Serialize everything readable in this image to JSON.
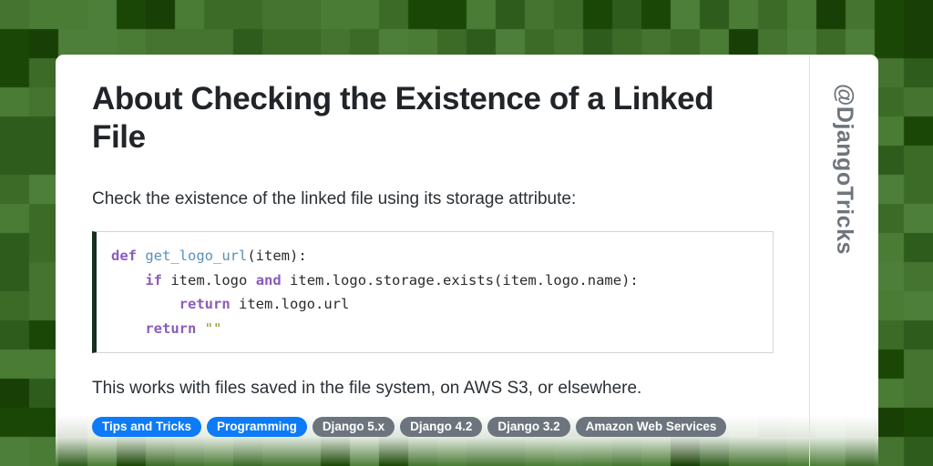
{
  "background": {
    "name": "pixel-checker-green",
    "cell_size": 32,
    "palette": [
      "#4a7c35",
      "#4e7f3a",
      "#3c6b28",
      "#2e5c1c",
      "#1b4706",
      "#183f05",
      "#447430"
    ]
  },
  "card": {
    "title": "About Checking the Existence of a Linked File",
    "intro_text": "Check the existence of the linked file using its storage attribute:",
    "outro_text": "This works with files saved in the file system, on AWS S3, or elsewhere.",
    "code": {
      "language": "python",
      "lines": [
        "def get_logo_url(item):",
        "    if item.logo and item.logo.storage.exists(item.logo.name):",
        "        return item.logo.url",
        "    return \"\""
      ],
      "plain_text": "def get_logo_url(item):\n    if item.logo and item.logo.storage.exists(item.logo.name):\n        return item.logo.url\n    return \"\"",
      "accent_color": "#16301d",
      "keyword_color": "#8b5cbb",
      "function_color": "#5b8fb8",
      "string_color": "#8a9a1e"
    },
    "tags": [
      {
        "label": "Tips and Tricks",
        "style": "primary"
      },
      {
        "label": "Programming",
        "style": "primary"
      },
      {
        "label": "Django 5.x",
        "style": "muted"
      },
      {
        "label": "Django 4.2",
        "style": "muted"
      },
      {
        "label": "Django 3.2",
        "style": "muted"
      },
      {
        "label": "Amazon Web Services",
        "style": "muted"
      }
    ],
    "tag_colors": {
      "primary": "#0d7bf7",
      "muted": "#6c757d"
    },
    "site_handle": "@DjangoTricks"
  }
}
